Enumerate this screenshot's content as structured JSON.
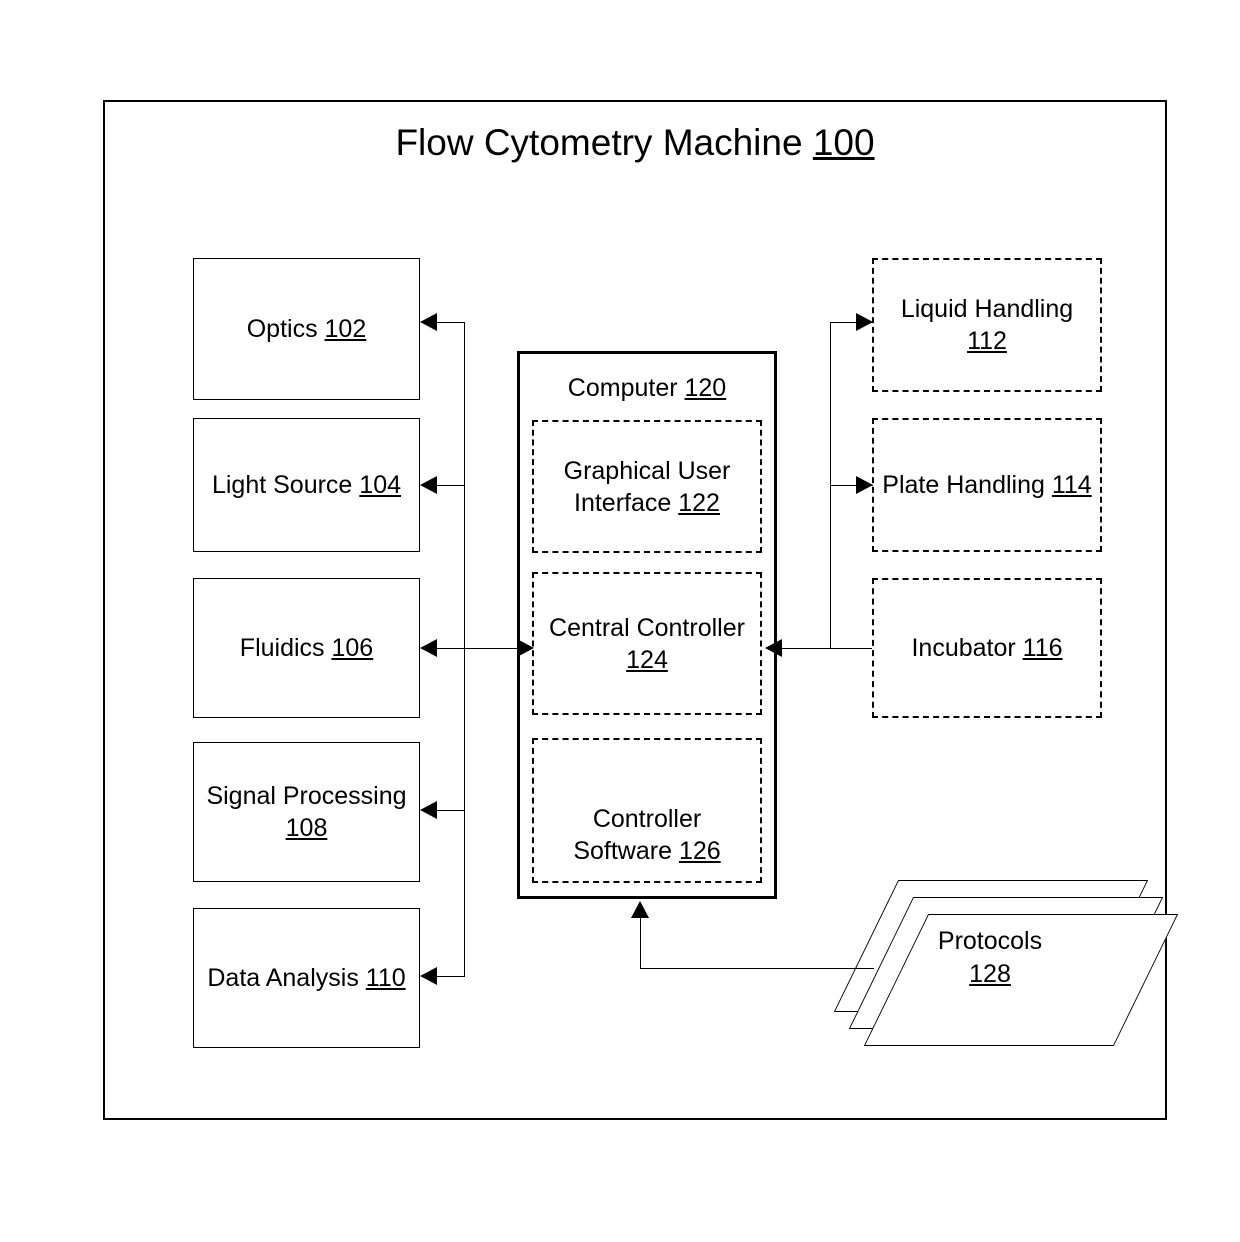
{
  "figure": {
    "title_text": "Flow Cytometry Machine ",
    "title_ref": "100"
  },
  "left_column": {
    "nodes": [
      {
        "label": "Optics ",
        "ref": "102",
        "name": "optics"
      },
      {
        "label": "Light Source ",
        "ref": "104",
        "name": "light-source"
      },
      {
        "label": "Fluidics ",
        "ref": "106",
        "name": "fluidics"
      },
      {
        "label": "Signal Processing ",
        "ref": "108",
        "name": "signal-processing"
      },
      {
        "label": "Data Analysis ",
        "ref": "110",
        "name": "data-analysis"
      }
    ]
  },
  "computer": {
    "label": "Computer ",
    "ref": "120",
    "children": [
      {
        "label": "Graphical User Interface ",
        "ref": "122",
        "name": "graphical-user-interface"
      },
      {
        "label": "Central Controller ",
        "ref": "124",
        "name": "central-controller"
      },
      {
        "label": "Controller Software ",
        "ref": "126",
        "name": "controller-software"
      }
    ]
  },
  "right_column": {
    "nodes": [
      {
        "label": "Liquid Handling ",
        "ref": "112",
        "name": "liquid-handling"
      },
      {
        "label": "Plate Handling ",
        "ref": "114",
        "name": "plate-handling"
      },
      {
        "label": "Incubator ",
        "ref": "116",
        "name": "incubator"
      }
    ]
  },
  "protocols": {
    "label": "Protocols",
    "ref": "128"
  },
  "colors": {
    "stroke": "#000000",
    "background": "#ffffff"
  }
}
